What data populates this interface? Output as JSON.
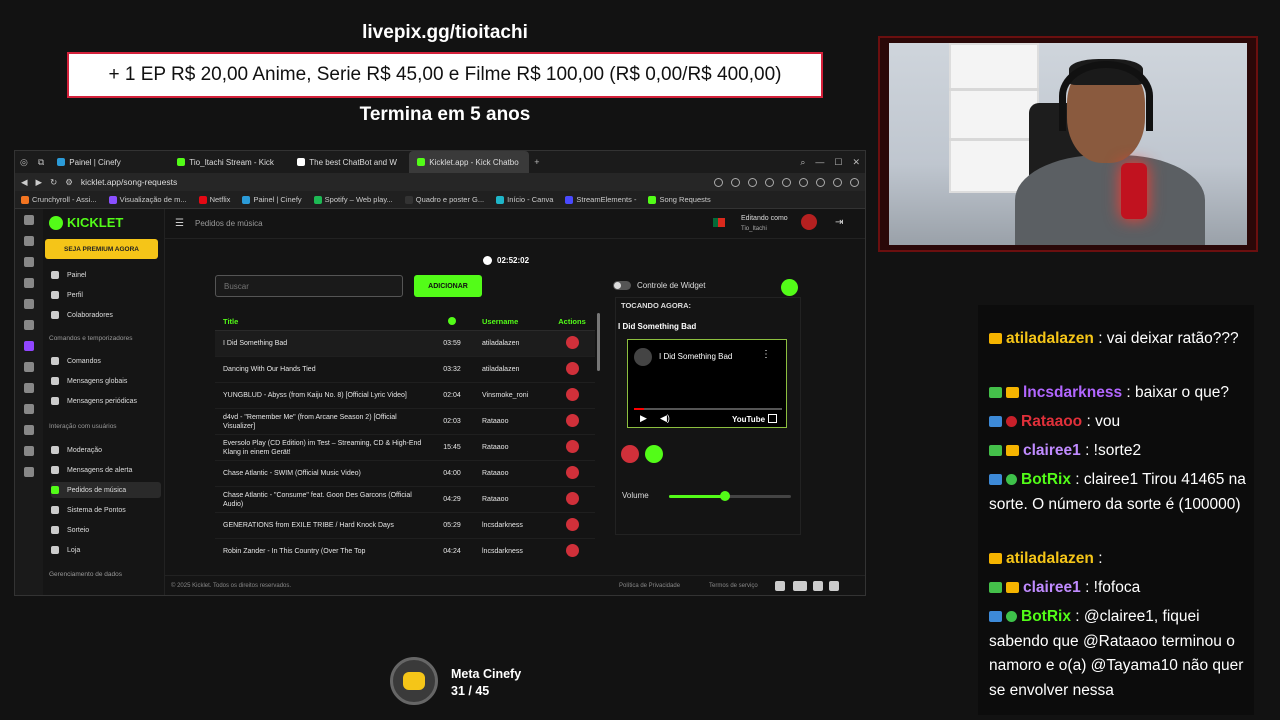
{
  "overlay": {
    "url": "livepix.gg/tioitachi",
    "goal": "+ 1 EP R$ 20,00 Anime, Serie R$ 45,00 e Filme R$ 100,00 (R$ 0,00/R$ 400,00)",
    "ends": "Termina em 5 anos"
  },
  "browser": {
    "tabs": [
      {
        "label": "Painel | Cinefy",
        "color": "#2b9bd8"
      },
      {
        "label": "Tio_Itachi Stream - Kick",
        "color": "#53fc18"
      },
      {
        "label": "The best ChatBot and W",
        "color": "#ffffff"
      },
      {
        "label": "Kicklet.app - Kick Chatbo",
        "color": "#53fc18"
      }
    ],
    "address": "kicklet.app/song-requests",
    "bookmarks": [
      {
        "label": "Crunchyroll - Assi...",
        "color": "#f47521"
      },
      {
        "label": "Visualização de m...",
        "color": "#8a4fff"
      },
      {
        "label": "Netflix",
        "color": "#e50914"
      },
      {
        "label": "Painel | Cinefy",
        "color": "#2b9bd8"
      },
      {
        "label": "Spotify – Web play...",
        "color": "#1db954"
      },
      {
        "label": "Quadro e poster G...",
        "color": "#333333"
      },
      {
        "label": "Início - Canva",
        "color": "#1fb6c9"
      },
      {
        "label": "StreamElements -",
        "color": "#4a4aff"
      },
      {
        "label": "Song Requests",
        "color": "#53fc18"
      }
    ]
  },
  "app": {
    "logo": "KICKLET",
    "premium": "SEJA PREMIUM AGORA",
    "menu": {
      "top": [
        "Painel",
        "Perfil",
        "Colaboradores"
      ],
      "section1": "Comandos e temporizadores",
      "cmds": [
        "Comandos",
        "Mensagens globais",
        "Mensagens periódicas"
      ],
      "section2": "Interação com usuários",
      "interaction": [
        "Moderação",
        "Mensagens de alerta",
        "Pedidos de música",
        "Sistema de Pontos",
        "Sorteio",
        "Loja"
      ],
      "section3": "Gerenciamento de dados"
    },
    "header": {
      "title": "Pedidos de música",
      "editing": "Editando como",
      "user": "Tio_Itachi"
    },
    "clock": "02:52:02",
    "search_placeholder": "Buscar",
    "add_button": "ADICIONAR",
    "table": {
      "headers": {
        "title": "Title",
        "username": "Username",
        "actions": "Actions"
      },
      "rows": [
        {
          "title": "I Did Something Bad",
          "time": "03:59",
          "user": "atiladalazen"
        },
        {
          "title": "Dancing With Our Hands Tied",
          "time": "03:32",
          "user": "atiladalazen"
        },
        {
          "title": "YUNGBLUD - Abyss (from Kaiju No. 8) [Official Lyric Video]",
          "time": "02:04",
          "user": "Vinsmoke_roni"
        },
        {
          "title": "d4vd - \"Remember Me\" (from Arcane Season 2) [Official Visualizer]",
          "time": "02:03",
          "user": "Rataaoo"
        },
        {
          "title": "Eversolo Play (CD Edition) im Test – Streaming, CD & High-End Klang in einem Gerät!",
          "time": "15:45",
          "user": "Rataaoo"
        },
        {
          "title": "Chase Atlantic - SWIM (Official Music Video)",
          "time": "04:00",
          "user": "Rataaoo"
        },
        {
          "title": "Chase Atlantic - \"Consume\" feat. Goon Des Garcons (Official Audio)",
          "time": "04:29",
          "user": "Rataaoo"
        },
        {
          "title": "GENERATIONS from EXILE TRIBE / Hard Knock Days",
          "time": "05:29",
          "user": "lncsdarkness"
        },
        {
          "title": "Robin Zander - In This Country (Over The Top",
          "time": "04:24",
          "user": "lncsdarkness"
        }
      ]
    },
    "widget_control": "Controle de Widget",
    "now_playing_label": "TOCANDO AGORA:",
    "now_playing": "I Did Something Bad",
    "youtube": {
      "title": "I Did Something Bad",
      "logo": "YouTube"
    },
    "volume_label": "Volume",
    "volume": 0.46,
    "footer": {
      "copy": "© 2025 Kicklet. Todos os direitos reservados.",
      "privacy": "Política de Privacidade",
      "terms": "Termos de serviço"
    }
  },
  "chat": [
    {
      "badges": [
        "crown"
      ],
      "user": "atiladalazen",
      "color": "#f5c518",
      "msg": ": vai deixar ratão???"
    },
    {
      "badges": [
        "plus",
        "crown"
      ],
      "user": "lncsdarkness",
      "color": "#b266ff",
      "msg": ": baixar o que?"
    },
    {
      "badges": [
        "sword",
        "red"
      ],
      "user": "Rataaoo",
      "color": "#e0303a",
      "msg": ": vou"
    },
    {
      "badges": [
        "plus",
        "crown"
      ],
      "user": "clairee1",
      "color": "#c08bff",
      "msg": ": !sorte2"
    },
    {
      "badges": [
        "sword",
        "check"
      ],
      "user": "BotRix",
      "color": "#53fc18",
      "msg": ": clairee1 Tirou 41465 na sorte. O número da sorte é (100000)"
    },
    {
      "badges": [
        "crown"
      ],
      "user": "atiladalazen",
      "color": "#f5c518",
      "msg": ":"
    },
    {
      "badges": [
        "plus",
        "crown"
      ],
      "user": "clairee1",
      "color": "#c08bff",
      "msg": ": !fofoca"
    },
    {
      "badges": [
        "sword",
        "check"
      ],
      "user": "BotRix",
      "color": "#53fc18",
      "msg": ": @clairee1, fiquei sabendo que @Rataaoo terminou o namoro e o(a) @Tayama10 não quer se envolver nessa"
    }
  ],
  "meta": {
    "title": "Meta Cinefy",
    "count": "31 / 45"
  }
}
